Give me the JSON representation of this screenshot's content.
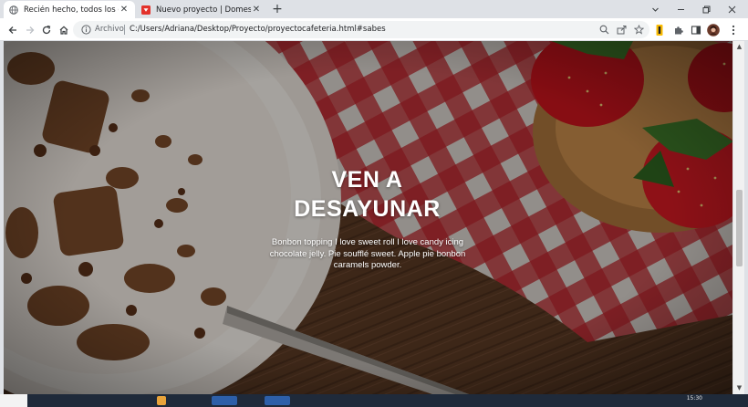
{
  "tabs": [
    {
      "title": "Recién hecho, todos los días",
      "active": true,
      "favicon": "globe-icon"
    },
    {
      "title": "Nuevo proyecto | Domestika",
      "active": false,
      "favicon": "domestika-icon"
    }
  ],
  "toolbar": {
    "archivo_label": "Archivo",
    "url": "C:/Users/Adriana/Desktop/Proyecto/proyectocafeteria.html#sabes"
  },
  "hero": {
    "title_line1": "VEN A",
    "title_line2": "DESAYUNAR",
    "text": "Bonbon topping I love sweet roll I love candy icing chocolate jelly. Pie soufflé sweet. Apple pie bonbon caramels powder."
  },
  "taskbar": {
    "clock": "15:30"
  },
  "colors": {
    "tab_strip": "#dee1e6",
    "domestika_red": "#e3322b",
    "checkered_red": "#c8262c",
    "wood_brown": "#5a3a22"
  }
}
